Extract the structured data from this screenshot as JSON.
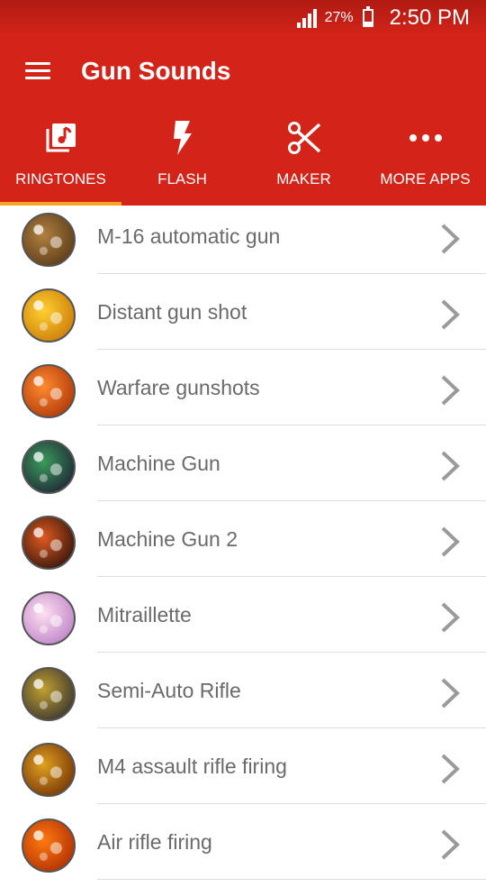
{
  "status_bar": {
    "battery_percent": "27%",
    "battery_level": 0.27,
    "time": "2:50 PM"
  },
  "app_bar": {
    "title": "Gun Sounds"
  },
  "tabs": [
    {
      "label": "RINGTONES",
      "icon": "ringtone-icon",
      "selected": true
    },
    {
      "label": "FLASH",
      "icon": "flash-icon",
      "selected": false
    },
    {
      "label": "MAKER",
      "icon": "scissors-icon",
      "selected": false
    },
    {
      "label": "MORE APPS",
      "icon": "more-dots-icon",
      "selected": false
    }
  ],
  "ringtones": [
    {
      "name": "M-16 automatic gun",
      "thumb_colors": [
        "#b08040",
        "#4a2e10"
      ]
    },
    {
      "name": "Distant gun shot",
      "thumb_colors": [
        "#ffd030",
        "#c06a00"
      ]
    },
    {
      "name": "Warfare gunshots",
      "thumb_colors": [
        "#ff8a30",
        "#a02800"
      ]
    },
    {
      "name": "Machine Gun",
      "thumb_colors": [
        "#3a9a5a",
        "#1a1030"
      ]
    },
    {
      "name": "Machine Gun 2",
      "thumb_colors": [
        "#e05a20",
        "#100808"
      ]
    },
    {
      "name": "Mitraillette",
      "thumb_colors": [
        "#ffe0f0",
        "#b070c0"
      ]
    },
    {
      "name": "Semi-Auto Rifle",
      "thumb_colors": [
        "#c0a030",
        "#202030"
      ]
    },
    {
      "name": "M4 assault rifle firing",
      "thumb_colors": [
        "#e0a020",
        "#602000"
      ]
    },
    {
      "name": "Air rifle firing",
      "thumb_colors": [
        "#ff7a10",
        "#a02000"
      ]
    }
  ],
  "colors": {
    "primary": "#d42419",
    "tab_indicator": "#f5a623",
    "list_text": "#6a6a6a",
    "chevron": "#9a9a9a"
  }
}
